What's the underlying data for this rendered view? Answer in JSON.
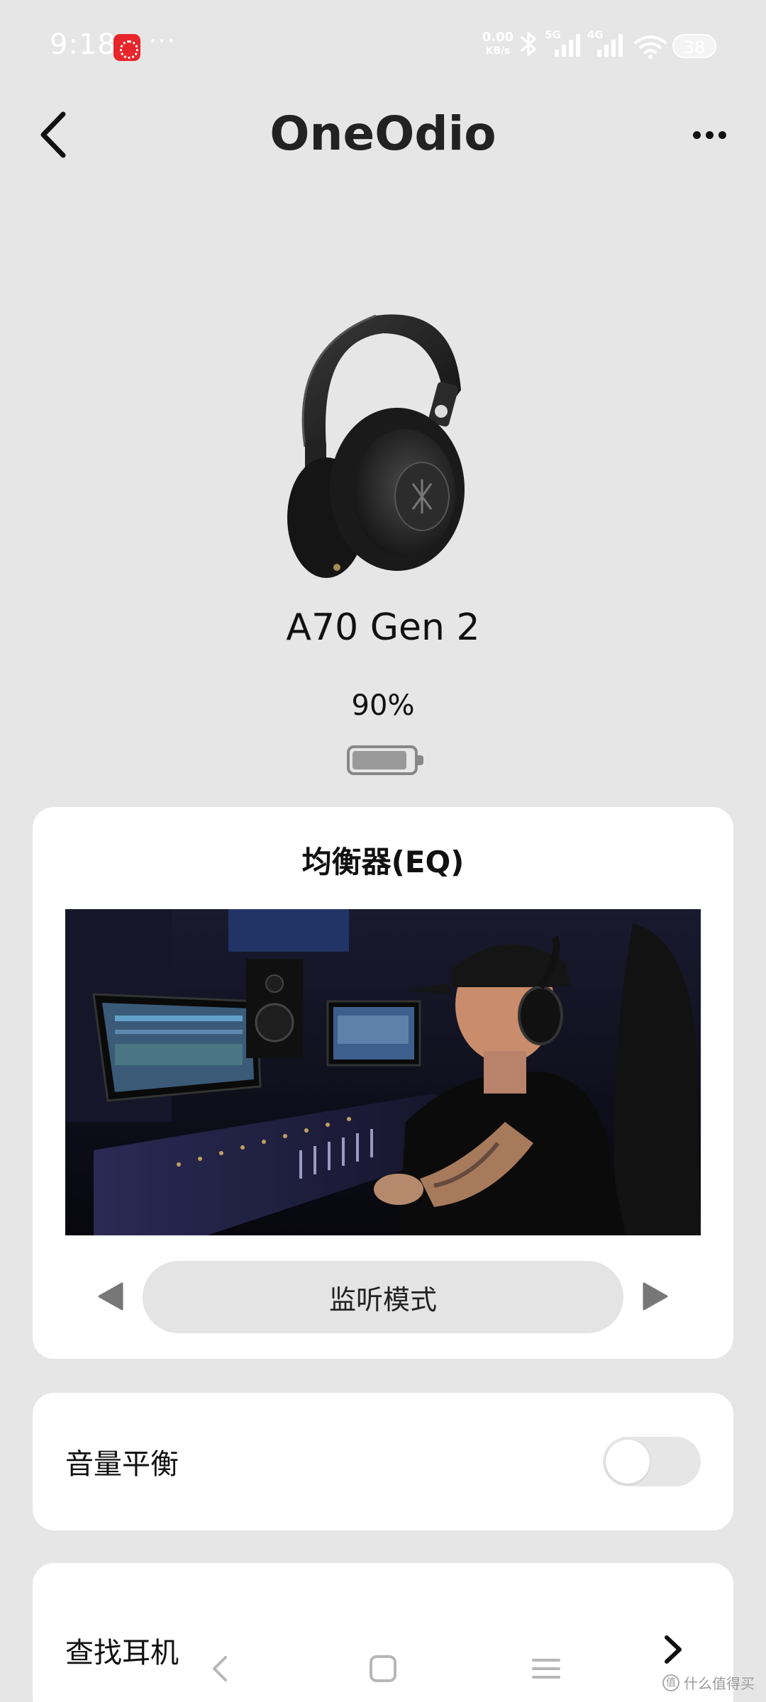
{
  "status_bar": {
    "time": "9:18",
    "more": "···",
    "net_speed_value": "0.00",
    "net_speed_unit": "KB/s",
    "signal_1": "5G",
    "signal_2": "4G",
    "battery": "38"
  },
  "app_bar": {
    "brand": "OneOdio"
  },
  "device": {
    "name": "A70 Gen 2",
    "battery_percent": "90%",
    "battery_level": 0.9
  },
  "eq": {
    "title": "均衡器(EQ)",
    "mode": "监听模式"
  },
  "volume_balance": {
    "label": "音量平衡",
    "enabled": false
  },
  "find_headphones": {
    "label": "查找耳机"
  },
  "watermark": {
    "text": "什么值得买",
    "badge": "值"
  },
  "colors": {
    "background": "#e6e6e6",
    "card": "#ffffff",
    "pill": "#e4e4e4",
    "text": "#111111"
  }
}
